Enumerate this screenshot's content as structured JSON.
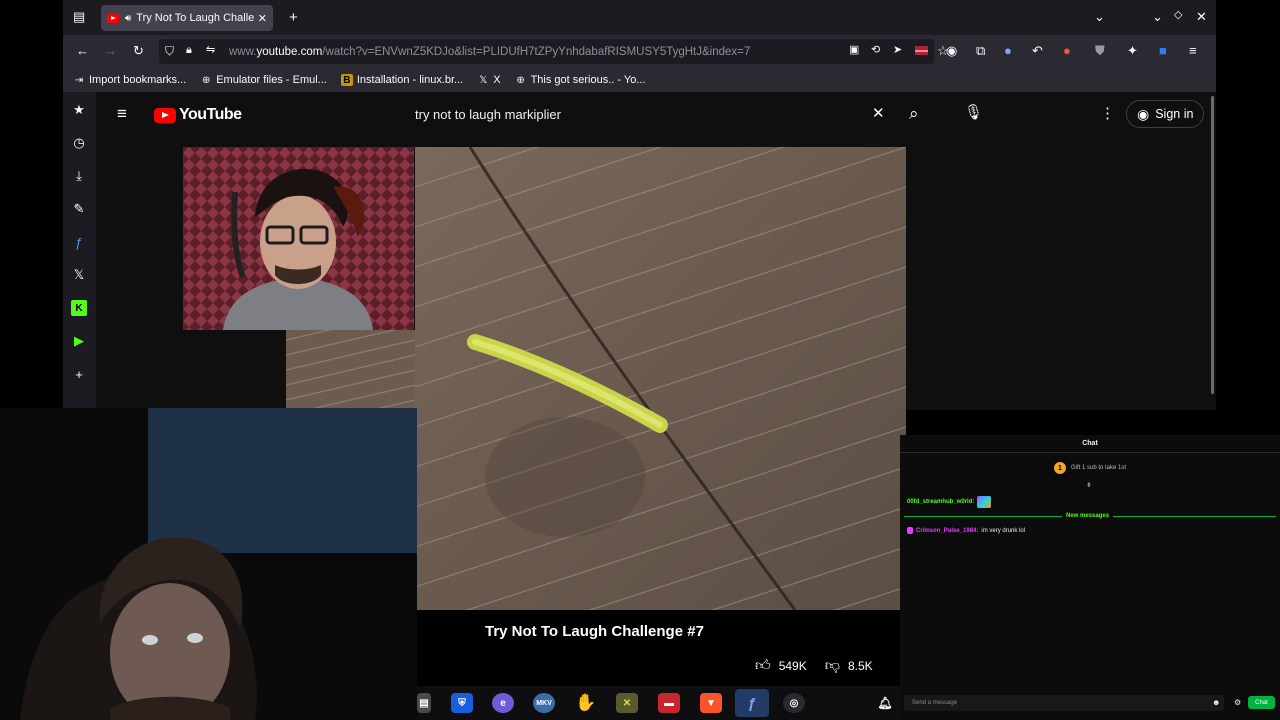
{
  "browser": {
    "tab_title": "Try Not To Laugh Challe",
    "url_prefix": "www.",
    "url_domain": "youtube.com",
    "url_rest": "/watch?v=ENVwnZ5KDJo&list=PLIDUfH7tZPyYnhdabafRISMUSY5TygHtJ&index=7",
    "bookmarks": [
      {
        "label": "Import bookmarks...",
        "icon": "import-icon"
      },
      {
        "label": "Emulator files - Emul...",
        "icon": "globe-icon"
      },
      {
        "label": "Installation - linux.br...",
        "icon": "brave-icon"
      },
      {
        "label": "X",
        "icon": "x-icon"
      },
      {
        "label": "This got serious.. - Yo...",
        "icon": "globe-icon"
      }
    ]
  },
  "youtube": {
    "logo_text": "YouTube",
    "search_value": "try not to laugh markiplier",
    "signin_label": "Sign in",
    "video_title": "Try Not To Laugh Challenge #7",
    "likes": "549K",
    "dislikes": "8.5K"
  },
  "chat": {
    "title": "Chat",
    "gift_text": "Gift 1 sub to take 1st",
    "user1": "00fd_streamhub_w0rld:",
    "new_messages": "New messages",
    "user2": "Crimson_Pulse_1984:",
    "user2_msg": "im very drunk lol",
    "input_placeholder": "Send a message",
    "send_label": "Chat"
  },
  "taskbar": {
    "apps": [
      {
        "name": "files-icon",
        "color": "#444448"
      },
      {
        "name": "bitwarden-icon",
        "color": "#175ddc"
      },
      {
        "name": "edge-icon",
        "color": "#6f5bd6"
      },
      {
        "name": "mkv-icon",
        "color": "#3b6ea8"
      },
      {
        "name": "waving-hand-icon",
        "color": "#f2b600"
      },
      {
        "name": "cross-icon",
        "color": "#8b8b3a"
      },
      {
        "name": "folder-red-icon",
        "color": "#c8262f"
      },
      {
        "name": "brave-icon",
        "color": "#fb542b"
      },
      {
        "name": "fedora-icon",
        "color": "#3c6eb4"
      },
      {
        "name": "obs-icon",
        "color": "#2a2a2e"
      },
      {
        "name": "bell-icon",
        "color": "#0e0e10"
      }
    ]
  },
  "colors": {
    "accent": "#ff0000",
    "chat_green": "#00b33c"
  }
}
